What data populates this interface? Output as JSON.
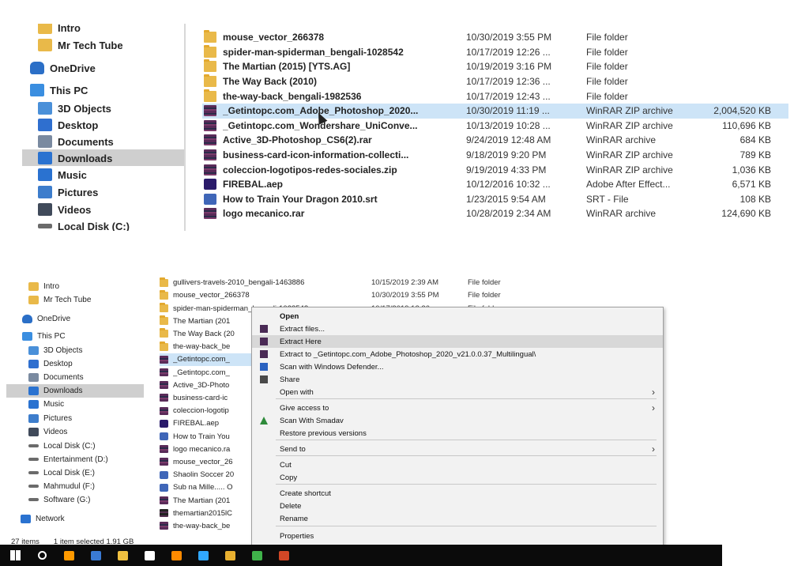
{
  "top_panel": {
    "sidebar": [
      {
        "label": "Intro",
        "icon": "folder-icon"
      },
      {
        "label": "Mr Tech Tube",
        "icon": "folder-icon"
      },
      {
        "label": "OneDrive",
        "icon": "onedrive-icon"
      },
      {
        "label": "This PC",
        "icon": "this-pc-icon"
      },
      {
        "label": "3D Objects",
        "icon": "3d-objects-icon"
      },
      {
        "label": "Desktop",
        "icon": "desktop-icon"
      },
      {
        "label": "Documents",
        "icon": "documents-icon"
      },
      {
        "label": "Downloads",
        "icon": "downloads-icon"
      },
      {
        "label": "Music",
        "icon": "music-icon"
      },
      {
        "label": "Pictures",
        "icon": "pictures-icon"
      },
      {
        "label": "Videos",
        "icon": "videos-icon"
      },
      {
        "label": "Local Disk (C:)",
        "icon": "drive-icon"
      }
    ],
    "files": [
      {
        "name": "mouse_vector_266378",
        "date": "10/30/2019 3:55 PM",
        "type": "File folder",
        "size": "",
        "icon": "folder"
      },
      {
        "name": "spider-man-spiderman_bengali-1028542",
        "date": "10/17/2019 12:26 ...",
        "type": "File folder",
        "size": "",
        "icon": "folder"
      },
      {
        "name": "The Martian (2015) [YTS.AG]",
        "date": "10/19/2019 3:16 PM",
        "type": "File folder",
        "size": "",
        "icon": "folder"
      },
      {
        "name": "The Way Back (2010)",
        "date": "10/17/2019 12:36 ...",
        "type": "File folder",
        "size": "",
        "icon": "folder"
      },
      {
        "name": "the-way-back_bengali-1982536",
        "date": "10/17/2019 12:43 ...",
        "type": "File folder",
        "size": "",
        "icon": "folder"
      },
      {
        "name": "_Getintopc.com_Adobe_Photoshop_2020...",
        "date": "10/30/2019 11:19 ...",
        "type": "WinRAR ZIP archive",
        "size": "2,004,520 KB",
        "icon": "rar"
      },
      {
        "name": "_Getintopc.com_Wondershare_UniConve...",
        "date": "10/13/2019 10:28 ...",
        "type": "WinRAR ZIP archive",
        "size": "110,696 KB",
        "icon": "rar"
      },
      {
        "name": "Active_3D-Photoshop_CS6(2).rar",
        "date": "9/24/2019 12:48 AM",
        "type": "WinRAR archive",
        "size": "684 KB",
        "icon": "rar"
      },
      {
        "name": "business-card-icon-information-collecti...",
        "date": "9/18/2019 9:20 PM",
        "type": "WinRAR ZIP archive",
        "size": "789 KB",
        "icon": "rar"
      },
      {
        "name": "coleccion-logotipos-redes-sociales.zip",
        "date": "9/19/2019 4:33 PM",
        "type": "WinRAR ZIP archive",
        "size": "1,036 KB",
        "icon": "rar"
      },
      {
        "name": "FIREBAL.aep",
        "date": "10/12/2016 10:32 ...",
        "type": "Adobe After Effect...",
        "size": "6,571 KB",
        "icon": "aep"
      },
      {
        "name": "How to Train Your Dragon 2010.srt",
        "date": "1/23/2015 9:54 AM",
        "type": "SRT - File",
        "size": "108 KB",
        "icon": "srt"
      },
      {
        "name": "logo mecanico.rar",
        "date": "10/28/2019 2:34 AM",
        "type": "WinRAR archive",
        "size": "124,690 KB",
        "icon": "rar"
      }
    ]
  },
  "bottom_panel": {
    "sidebar": [
      {
        "label": "Intro",
        "icon": "folder-icon"
      },
      {
        "label": "Mr Tech Tube",
        "icon": "folder-icon"
      },
      {
        "label": "OneDrive",
        "icon": "onedrive-icon"
      },
      {
        "label": "This PC",
        "icon": "this-pc-icon"
      },
      {
        "label": "3D Objects",
        "icon": "3d-objects-icon"
      },
      {
        "label": "Desktop",
        "icon": "desktop-icon"
      },
      {
        "label": "Documents",
        "icon": "documents-icon"
      },
      {
        "label": "Downloads",
        "icon": "downloads-icon"
      },
      {
        "label": "Music",
        "icon": "music-icon"
      },
      {
        "label": "Pictures",
        "icon": "pictures-icon"
      },
      {
        "label": "Videos",
        "icon": "videos-icon"
      },
      {
        "label": "Local Disk (C:)",
        "icon": "drive-icon"
      },
      {
        "label": "Entertainment (D:)",
        "icon": "drive-icon"
      },
      {
        "label": "Local Disk (E:)",
        "icon": "drive-icon"
      },
      {
        "label": "Mahmudul (F:)",
        "icon": "drive-icon"
      },
      {
        "label": "Software (G:)",
        "icon": "drive-icon"
      },
      {
        "label": "Network",
        "icon": "network-icon"
      }
    ],
    "files": [
      {
        "name": "gullivers-travels-2010_bengali-1463886",
        "date": "10/15/2019 2:39 AM",
        "type": "File folder",
        "icon": "folder"
      },
      {
        "name": "mouse_vector_266378",
        "date": "10/30/2019 3:55 PM",
        "type": "File folder",
        "icon": "folder"
      },
      {
        "name": "spider-man-spiderman_bengali-1028542",
        "date": "10/17/2019 12:26 ...",
        "type": "File folder",
        "icon": "folder"
      },
      {
        "name": "The Martian (201",
        "date": "",
        "type": "",
        "icon": "folder"
      },
      {
        "name": "The Way Back (20",
        "date": "",
        "type": "",
        "icon": "folder"
      },
      {
        "name": "the-way-back_be",
        "date": "",
        "type": "",
        "icon": "folder"
      },
      {
        "name": "_Getintopc.com_",
        "date": "",
        "type": "",
        "icon": "rar"
      },
      {
        "name": "_Getintopc.com_",
        "date": "",
        "type": "",
        "icon": "rar"
      },
      {
        "name": "Active_3D-Photo",
        "date": "",
        "type": "",
        "icon": "rar"
      },
      {
        "name": "business-card-ic",
        "date": "",
        "type": "",
        "icon": "rar"
      },
      {
        "name": "coleccion-logotip",
        "date": "",
        "type": "",
        "icon": "rar"
      },
      {
        "name": "FIREBAL.aep",
        "date": "",
        "type": "",
        "icon": "aep"
      },
      {
        "name": "How to Train You",
        "date": "",
        "type": "",
        "icon": "srt"
      },
      {
        "name": "logo mecanico.ra",
        "date": "",
        "type": "",
        "icon": "rar"
      },
      {
        "name": "mouse_vector_26",
        "date": "",
        "type": "",
        "icon": "rar"
      },
      {
        "name": "Shaolin Soccer 20",
        "date": "",
        "type": "",
        "icon": "srt"
      },
      {
        "name": "Sub na Mille..... O",
        "date": "",
        "type": "",
        "icon": "srt"
      },
      {
        "name": "The Martian (201",
        "date": "",
        "type": "",
        "icon": "rar"
      },
      {
        "name": "themartian2015lC",
        "date": "",
        "type": "",
        "icon": "rarblk"
      },
      {
        "name": "the-way-back_be",
        "date": "",
        "type": "",
        "icon": "rar"
      }
    ],
    "status": {
      "items": "27 items",
      "selected": "1 item selected 1.91 GB"
    }
  },
  "context_menu": {
    "items": [
      {
        "label": "Open",
        "bold": true
      },
      {
        "label": "Extract files...",
        "icon": "winrar-icon"
      },
      {
        "label": "Extract Here",
        "icon": "winrar-icon",
        "highlight": true
      },
      {
        "label": "Extract to _Getintopc.com_Adobe_Photoshop_2020_v21.0.0.37_Multilingual\\",
        "icon": "winrar-icon"
      },
      {
        "label": "Scan with Windows Defender...",
        "icon": "defender-icon"
      },
      {
        "label": "Share",
        "icon": "share-icon"
      },
      {
        "label": "Open with",
        "submenu": true
      },
      {
        "label": "Give access to",
        "submenu": true
      },
      {
        "label": "Scan With Smadav",
        "icon": "smadav-icon"
      },
      {
        "label": "Restore previous versions"
      },
      {
        "label": "Send to",
        "submenu": true
      },
      {
        "label": "Cut"
      },
      {
        "label": "Copy"
      },
      {
        "label": "Create shortcut"
      },
      {
        "label": "Delete"
      },
      {
        "label": "Rename"
      },
      {
        "label": "Properties"
      }
    ]
  },
  "taskbar": {
    "icons": [
      "windows-start-icon",
      "cortana-icon",
      "illustrator-icon",
      "file-manager-icon",
      "explorer-icon",
      "mail-icon",
      "vlc-icon",
      "photoshop-icon",
      "chrome-icon",
      "camtasia-icon",
      "powerpoint-icon"
    ]
  }
}
